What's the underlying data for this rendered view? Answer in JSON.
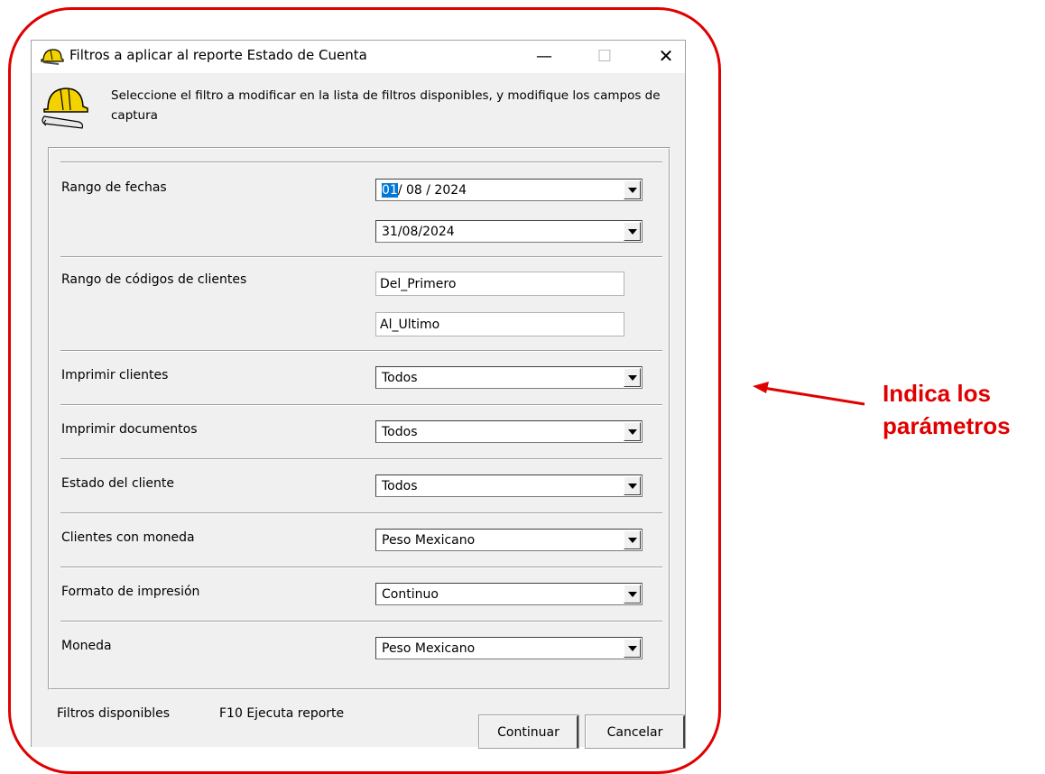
{
  "window": {
    "title": "Filtros a aplicar al reporte Estado de Cuenta",
    "minimize_glyph": "—",
    "maximize_glyph": "☐",
    "close_glyph": "✕"
  },
  "header": {
    "instructions": "Seleccione el filtro a modificar  en la lista de filtros disponibles, y modifique los campos de  captura"
  },
  "filters": {
    "date_range": {
      "label": "Rango de fechas",
      "from_day": "01",
      "from_rest": "/ 08 / 2024",
      "to": "31/08/2024"
    },
    "client_codes": {
      "label": "Rango de códigos de clientes",
      "from": "Del_Primero",
      "to": "Al_Ultimo"
    },
    "print_clients": {
      "label": "Imprimir clientes",
      "value": "Todos"
    },
    "print_documents": {
      "label": "Imprimir documentos",
      "value": "Todos"
    },
    "client_status": {
      "label": "Estado del cliente",
      "value": "Todos"
    },
    "clients_currency": {
      "label": "Clientes con moneda",
      "value": "Peso Mexicano"
    },
    "print_format": {
      "label": "Formato de impresión",
      "value": "Continuo"
    },
    "currency": {
      "label": "Moneda",
      "value": "Peso Mexicano"
    }
  },
  "footer": {
    "available_filters": "Filtros disponibles",
    "f10_hint": "F10 Ejecuta reporte",
    "continue_label": "Continuar",
    "cancel_label": "Cancelar"
  },
  "annotation": {
    "line1": "Indica los",
    "line2": "parámetros",
    "color": "#e00000"
  },
  "colors": {
    "selection": "#0078d7",
    "window_bg": "#f0f0f0"
  }
}
